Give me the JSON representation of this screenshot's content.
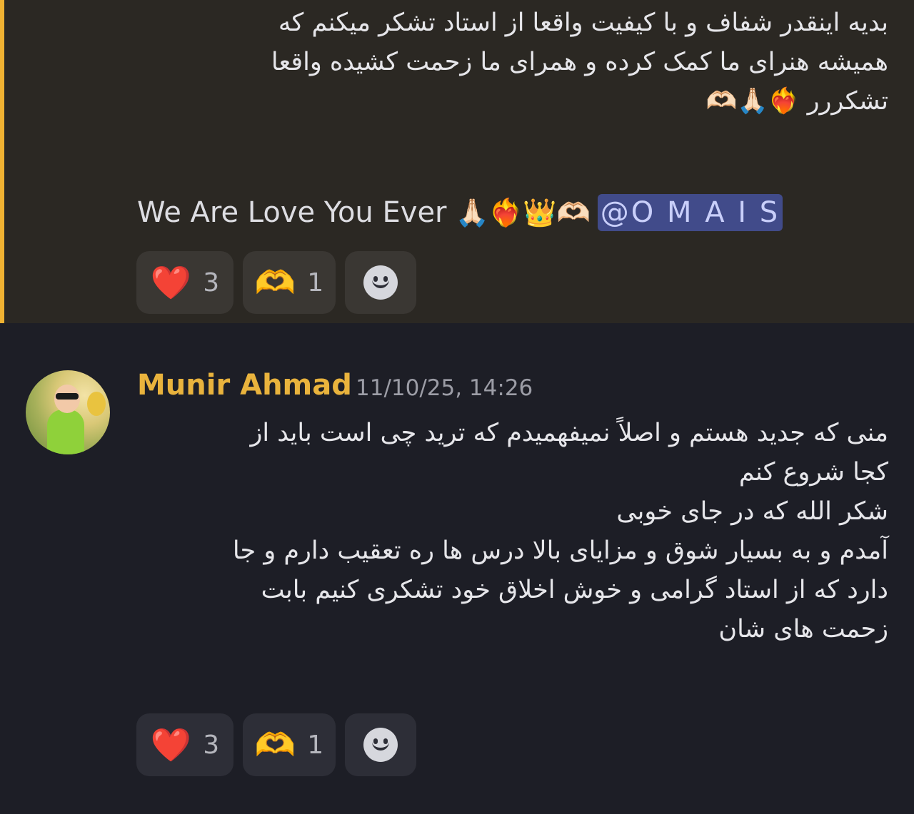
{
  "message_1": {
    "text_lines": [
      "بدیه اینقدر شفاف و با کیفیت واقعا از استاد تشکر میکنم که",
      "همیشه هنرای ما کمک کرده و همرای ما زحمت کشیده واقعا",
      "تشکررر ❤️‍🔥🙏🏻🫶🏻"
    ],
    "english_line": "We Are Love You Ever",
    "english_emojis": "🙏🏻❤️‍🔥👑🫶🏻",
    "mention": "@O M A I S",
    "reactions": [
      {
        "emoji": "❤️",
        "count": "3"
      },
      {
        "emoji": "🫶",
        "count": "1"
      }
    ]
  },
  "message_2": {
    "author": "Munir Ahmad",
    "timestamp": "11/10/25, 14:26",
    "text_lines": [
      "منی که جدید هستم و اصلاً نمیفهمیدم که ترید چی است باید از",
      "کجا شروع کنم",
      "شکر الله که در جای خوبی",
      " آمدم و به بسیار شوق و مزایای بالا درس ها ره تعقیب دارم و جا",
      "دارد که از استاد گرامی و خوش اخلاق خود تشکری کنیم بابت",
      "زحمت های شان"
    ],
    "reactions": [
      {
        "emoji": "❤️",
        "count": "3"
      },
      {
        "emoji": "🫶",
        "count": "1"
      }
    ]
  },
  "icons": {
    "add_reaction": "smile-icon",
    "mention_bar_color": "#f0b232",
    "author_color": "#e9b33d"
  }
}
